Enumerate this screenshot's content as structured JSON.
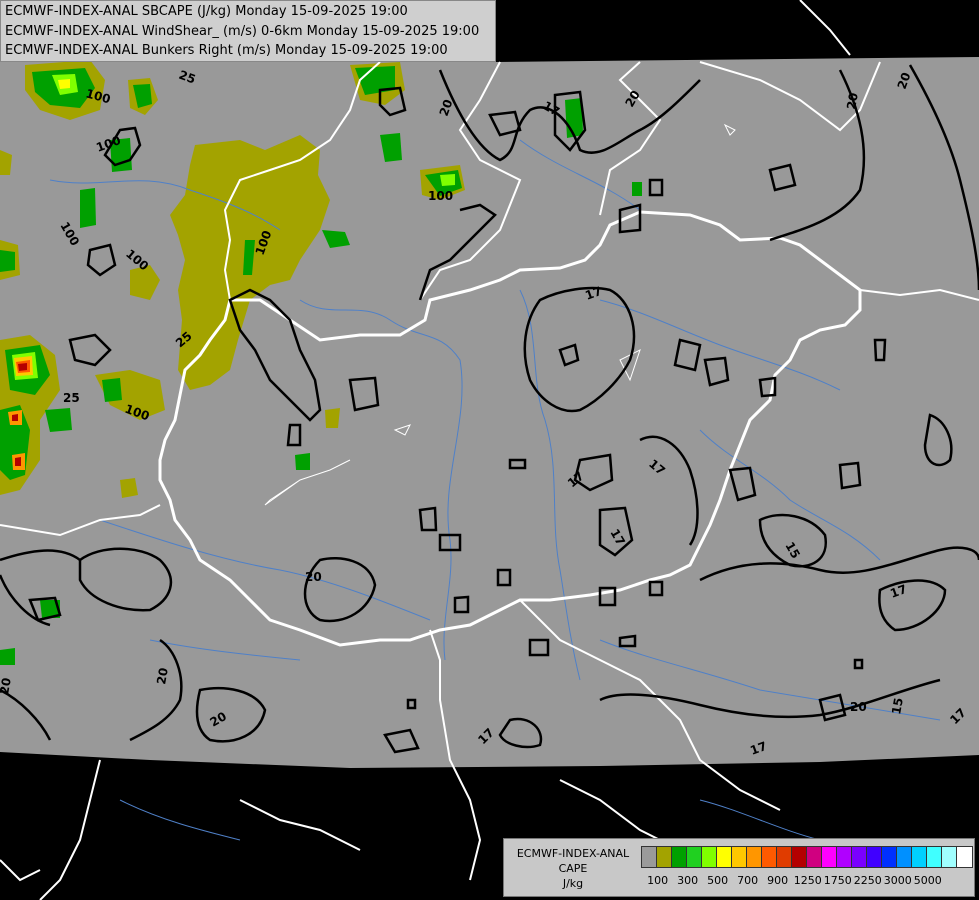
{
  "map": {
    "contour_labels": [
      {
        "id": "c1",
        "text": "25"
      },
      {
        "id": "c2",
        "text": "100"
      },
      {
        "id": "c3",
        "text": "100"
      },
      {
        "id": "c4",
        "text": "100"
      },
      {
        "id": "c5",
        "text": "100"
      },
      {
        "id": "c6",
        "text": "100"
      },
      {
        "id": "c7",
        "text": "100"
      },
      {
        "id": "c8",
        "text": "25"
      },
      {
        "id": "c9",
        "text": "100"
      },
      {
        "id": "c10",
        "text": "25"
      },
      {
        "id": "c11",
        "text": "20"
      },
      {
        "id": "c12",
        "text": "17"
      },
      {
        "id": "c13",
        "text": "20"
      },
      {
        "id": "c14",
        "text": "20"
      },
      {
        "id": "c15",
        "text": "17"
      },
      {
        "id": "c16",
        "text": "17"
      },
      {
        "id": "c17",
        "text": "17"
      },
      {
        "id": "c18",
        "text": "17"
      },
      {
        "id": "c19",
        "text": "15"
      },
      {
        "id": "c20",
        "text": "17"
      },
      {
        "id": "c21",
        "text": "20"
      },
      {
        "id": "c22",
        "text": "20"
      },
      {
        "id": "c23",
        "text": "20"
      },
      {
        "id": "c24",
        "text": "17"
      },
      {
        "id": "c25",
        "text": "17"
      },
      {
        "id": "c26",
        "text": "20"
      },
      {
        "id": "c27",
        "text": "15"
      },
      {
        "id": "c28",
        "text": "17"
      }
    ],
    "colors": {
      "land_black": "#000000",
      "domain_gray": "#999999",
      "border_white": "#ffffff",
      "river": "#4f80c8",
      "contour": "#000000"
    }
  },
  "title_lines": [
    "ECMWF-INDEX-ANAL SBCAPE (J/kg) Monday 15-09-2025 19:00",
    "ECMWF-INDEX-ANAL WindShear_ (m/s) 0-6km Monday 15-09-2025 19:00",
    "ECMWF-INDEX-ANAL Bunkers Right (m/s) Monday 15-09-2025 19:00"
  ],
  "legend": {
    "caption_lines": [
      "ECMWF-INDEX-ANAL",
      "CAPE",
      "J/kg"
    ],
    "colors": [
      "#9a9a9a",
      "#a3a300",
      "#00a000",
      "#20d020",
      "#80ff00",
      "#ffff00",
      "#ffc800",
      "#ff9600",
      "#ff5a00",
      "#e03c00",
      "#b40000",
      "#d00080",
      "#ff00ff",
      "#b000ff",
      "#7a00ff",
      "#4000ff",
      "#0030ff",
      "#0090ff",
      "#00d0ff",
      "#40ffff",
      "#a0ffff",
      "#ffffff"
    ],
    "tick_labels": [
      "100",
      "300",
      "500",
      "700",
      "900",
      "1250",
      "1750",
      "2250",
      "3000",
      "5000"
    ]
  }
}
